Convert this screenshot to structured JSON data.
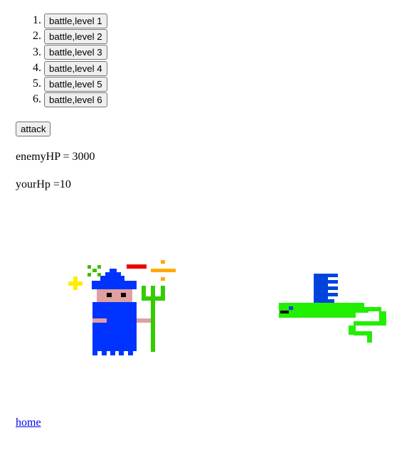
{
  "levels": [
    {
      "label": "battle,level 1"
    },
    {
      "label": "battle,level 2"
    },
    {
      "label": "battle,level 3"
    },
    {
      "label": "battle,level 4"
    },
    {
      "label": "battle,level 5"
    },
    {
      "label": "battle,level 6"
    }
  ],
  "attack_label": "attack",
  "enemy_hp_text": "enemyHP = 3000",
  "your_hp_text": "yourHp =10",
  "home_link": "home",
  "colors": {
    "wizard_robe": "#0033ff",
    "wizard_face": "#e0a0a0",
    "trident": "#33cc00",
    "enemy_body": "#22ee00",
    "enemy_fin": "#0044dd",
    "spell_yellow": "#ffee00",
    "spell_red": "#ee0000",
    "spell_orange": "#ffaa00",
    "spell_green": "#44bb00"
  }
}
